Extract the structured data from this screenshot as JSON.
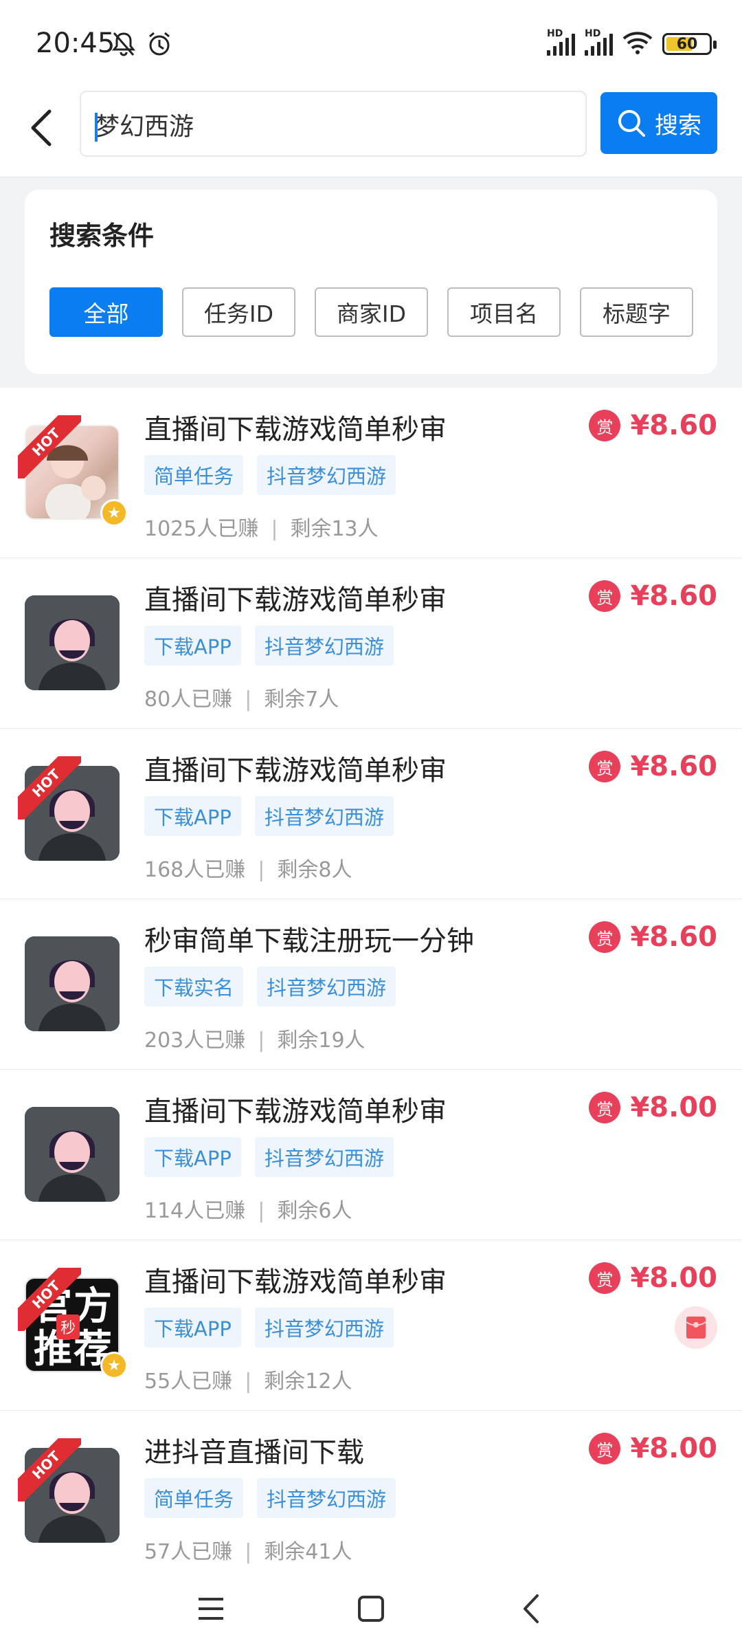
{
  "status_bar": {
    "time": "20:45",
    "battery_level": "60",
    "icons": [
      "bell-off-icon",
      "alarm-icon",
      "hd-signal-icon",
      "hd-signal-icon",
      "wifi-icon",
      "battery-icon"
    ]
  },
  "search": {
    "query": "梦幻西游",
    "button_label": "搜索"
  },
  "filters": {
    "title": "搜索条件",
    "chips": [
      {
        "label": "全部",
        "active": true
      },
      {
        "label": "任务ID",
        "active": false
      },
      {
        "label": "商家ID",
        "active": false
      },
      {
        "label": "项目名",
        "active": false
      },
      {
        "label": "标题字",
        "active": false
      }
    ]
  },
  "tasks": [
    {
      "title": "直播间下载游戏简单秒审",
      "tags": [
        "简单任务",
        "抖音梦幻西游"
      ],
      "earned": "1025人已赚",
      "remaining": "剩余13人",
      "reward_icon": "赏",
      "price": "¥8.60",
      "hot": true,
      "hot_label": "HOT"
    },
    {
      "title": "直播间下载游戏简单秒审",
      "tags": [
        "下载APP",
        "抖音梦幻西游"
      ],
      "earned": "80人已赚",
      "remaining": "剩余7人",
      "reward_icon": "赏",
      "price": "¥8.60",
      "hot": false
    },
    {
      "title": "直播间下载游戏简单秒审",
      "tags": [
        "下载APP",
        "抖音梦幻西游"
      ],
      "earned": "168人已赚",
      "remaining": "剩余8人",
      "reward_icon": "赏",
      "price": "¥8.60",
      "hot": true,
      "hot_label": "HOT"
    },
    {
      "title": "秒审简单下载注册玩一分钟",
      "tags": [
        "下载实名",
        "抖音梦幻西游"
      ],
      "earned": "203人已赚",
      "remaining": "剩余19人",
      "reward_icon": "赏",
      "price": "¥8.60",
      "hot": false
    },
    {
      "title": "直播间下载游戏简单秒审",
      "tags": [
        "下载APP",
        "抖音梦幻西游"
      ],
      "earned": "114人已赚",
      "remaining": "剩余6人",
      "reward_icon": "赏",
      "price": "¥8.00",
      "hot": false
    },
    {
      "title": "直播间下载游戏简单秒审",
      "tags": [
        "下载APP",
        "抖音梦幻西游"
      ],
      "earned": "55人已赚",
      "remaining": "剩余12人",
      "reward_icon": "赏",
      "price": "¥8.00",
      "hot": true,
      "hot_label": "HOT",
      "avatar_text": "官方推荐",
      "avatar_tag": "秒"
    },
    {
      "title": "进抖音直播间下载",
      "tags": [
        "简单任务",
        "抖音梦幻西游"
      ],
      "earned": "57人已赚",
      "remaining": "剩余41人",
      "reward_icon": "赏",
      "price": "¥8.00",
      "hot": true,
      "hot_label": "HOT"
    }
  ],
  "nav": {
    "items": [
      "menu-icon",
      "home-square-icon",
      "back-chevron-icon"
    ]
  },
  "colors": {
    "accent_blue": "#0a7df0",
    "price_red": "#e8405a",
    "tag_blue": "#3b8fd9"
  }
}
